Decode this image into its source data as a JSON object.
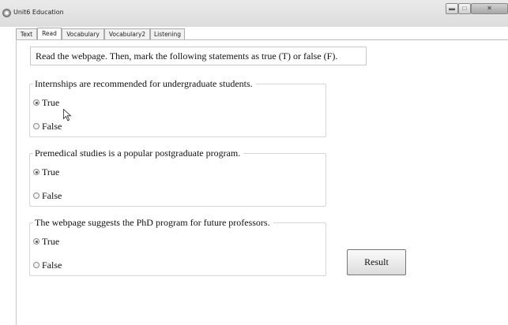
{
  "window": {
    "title": "Unit6 Education",
    "icon": "app-globe-icon",
    "controls": [
      "minimize",
      "maximize",
      "close"
    ]
  },
  "tabs": [
    {
      "label": "Text",
      "active": false
    },
    {
      "label": "Read",
      "active": true
    },
    {
      "label": "Vocabulary",
      "active": false
    },
    {
      "label": "Vocabulary2",
      "active": false
    },
    {
      "label": "Listening",
      "active": false
    }
  ],
  "instruction": "Read the webpage. Then, mark the following statements as true (T) or false (F).",
  "questions": [
    {
      "statement": "Internships are recommended for undergraduate students.",
      "options": [
        "True",
        "False"
      ],
      "selected": "True"
    },
    {
      "statement": "Premedical studies is a popular postgraduate program.",
      "options": [
        "True",
        "False"
      ],
      "selected": "True"
    },
    {
      "statement": "The webpage suggests the PhD program for future professors.",
      "options": [
        "True",
        "False"
      ],
      "selected": "True"
    }
  ],
  "result_button": {
    "label": "Result"
  }
}
